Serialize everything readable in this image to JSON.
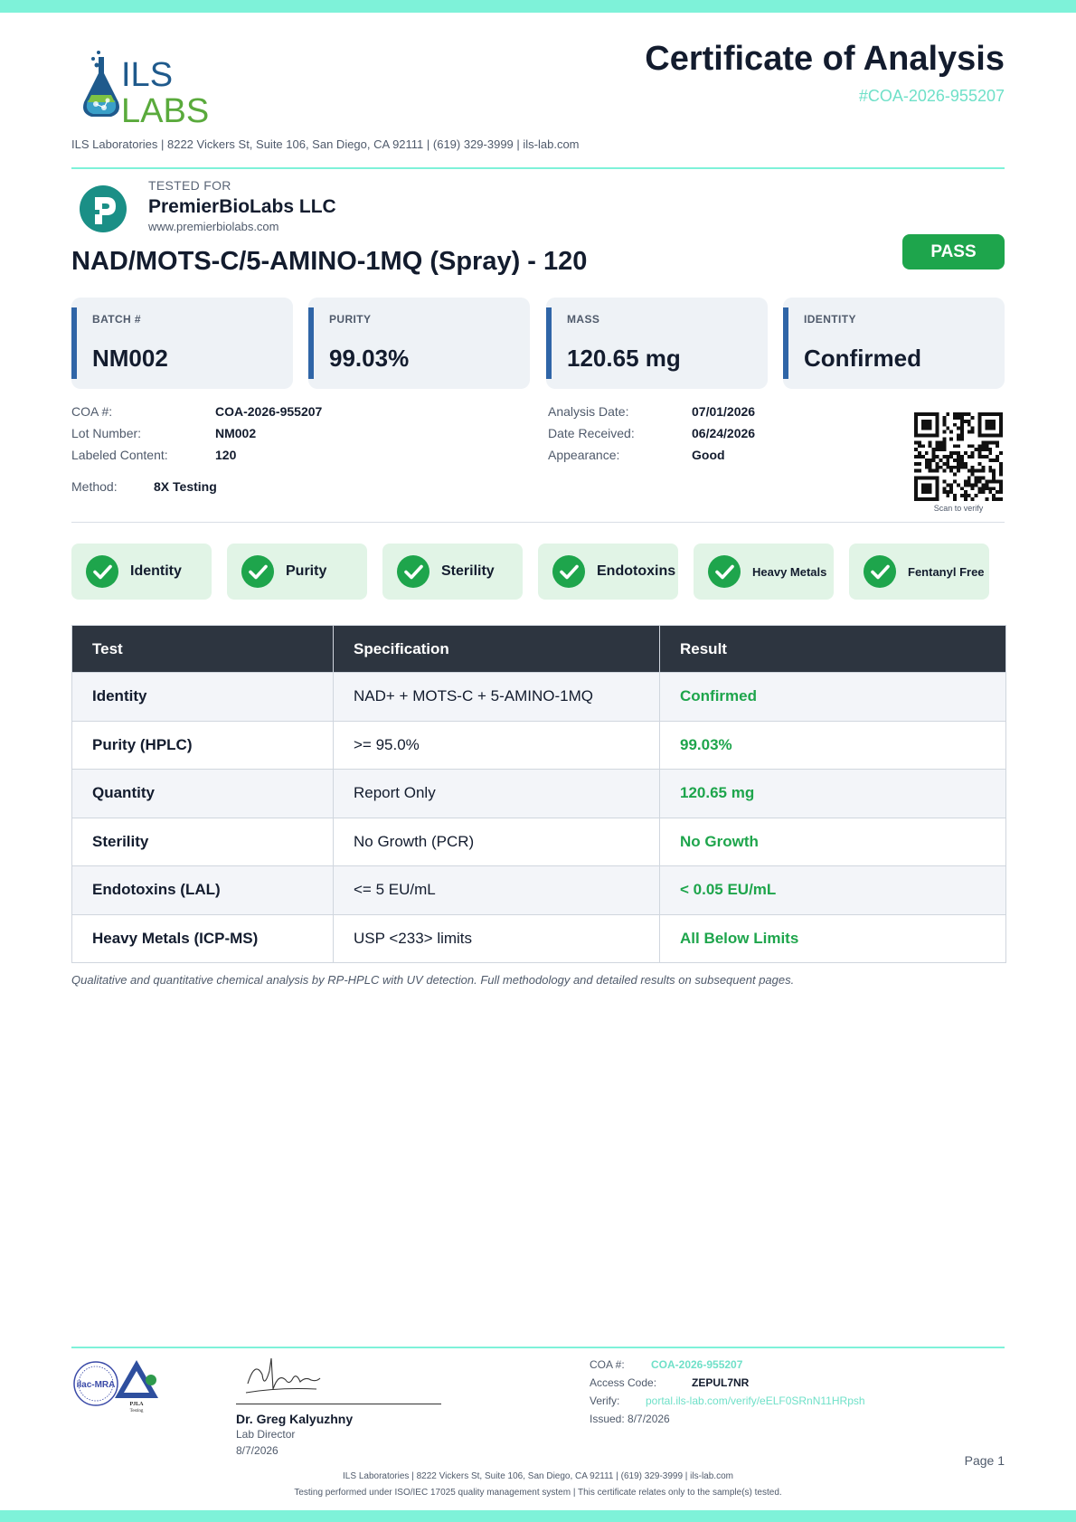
{
  "header": {
    "logo_text_1": "ILS",
    "logo_text_2": "LABS",
    "title": "Certificate of Analysis",
    "coa_ref": "#COA-2026-955207",
    "address_line": "ILS Laboratories  |  8222 Vickers St, Suite 106, San Diego, CA 92111  |  (619) 329-3999  |  ils-lab.com"
  },
  "client": {
    "tested_for_label": "TESTED FOR",
    "name": "PremierBioLabs LLC",
    "url": "www.premierbiolabs.com",
    "logo_icon": "client-logo-icon"
  },
  "product": {
    "name": "NAD/MOTS-C/5-AMINO-1MQ (Spray) - 120",
    "status": "PASS"
  },
  "stats": [
    {
      "label": "BATCH #",
      "value": "NM002"
    },
    {
      "label": "PURITY",
      "value": "99.03%"
    },
    {
      "label": "MASS",
      "value": "120.65 mg"
    },
    {
      "label": "IDENTITY",
      "value": "Confirmed"
    }
  ],
  "meta_left": [
    {
      "key": "COA #:",
      "value": "COA-2026-955207"
    },
    {
      "key": "Lot Number:",
      "value": "NM002"
    },
    {
      "key": "Labeled Content:",
      "value": "120"
    }
  ],
  "meta_right": [
    {
      "key": "Analysis Date:",
      "value": "07/01/2026"
    },
    {
      "key": "Date Received:",
      "value": "06/24/2026"
    },
    {
      "key": "Appearance:",
      "value": "Good"
    }
  ],
  "method": {
    "key": "Method:",
    "value": "8X Testing"
  },
  "qr": {
    "caption": "Scan to verify"
  },
  "chips": [
    {
      "label": "Identity"
    },
    {
      "label": "Purity"
    },
    {
      "label": "Sterility"
    },
    {
      "label": "Endotoxins"
    },
    {
      "label": "Heavy Metals"
    },
    {
      "label": "Fentanyl Free"
    }
  ],
  "table": {
    "headers": [
      "Test",
      "Specification",
      "Result"
    ],
    "rows": [
      [
        "Identity",
        "NAD+ + MOTS-C + 5-AMINO-1MQ",
        "Confirmed"
      ],
      [
        "Purity (HPLC)",
        ">= 95.0%",
        "99.03%"
      ],
      [
        "Quantity",
        "Report Only",
        "120.65 mg"
      ],
      [
        "Sterility",
        "No Growth (PCR)",
        "No Growth"
      ],
      [
        "Endotoxins (LAL)",
        "<= 5 EU/mL",
        "< 0.05 EU/mL"
      ],
      [
        "Heavy Metals (ICP-MS)",
        "USP <233> limits",
        "All Below Limits"
      ]
    ]
  },
  "note": "Qualitative and quantitative chemical analysis by RP-HPLC with UV detection. Full methodology and detailed results on subsequent pages.",
  "footer": {
    "accreditation_text_1": "ilac-MRA",
    "accreditation_text_2": "PJLA",
    "accreditation_text_3": "Testing",
    "signatory_name": "Dr. Greg Kalyuzhny",
    "signatory_role": "Lab Director",
    "signatory_date": "8/7/2026",
    "coa_key": "COA #:",
    "coa_value": "COA-2026-955207",
    "access_key": "Access Code:",
    "access_value": "ZEPUL7NR",
    "verify_key": "Verify:",
    "verify_value": "portal.ils-lab.com/verify/eELF0SRnN11HRpsh",
    "issued": "Issued: 8/7/2026",
    "page": "Page 1",
    "line1": "ILS Laboratories  |  8222 Vickers St, Suite 106, San Diego, CA 92111  |  (619) 329-3999  |  ils-lab.com",
    "line2": "Testing performed under ISO/IEC 17025 quality management system  |  This certificate relates only to the sample(s) tested."
  },
  "colors": {
    "accent_teal": "#7ef2d9",
    "pass_green": "#1ea54c",
    "stat_bar_blue": "#2f65a7",
    "table_header": "#2d3540"
  }
}
